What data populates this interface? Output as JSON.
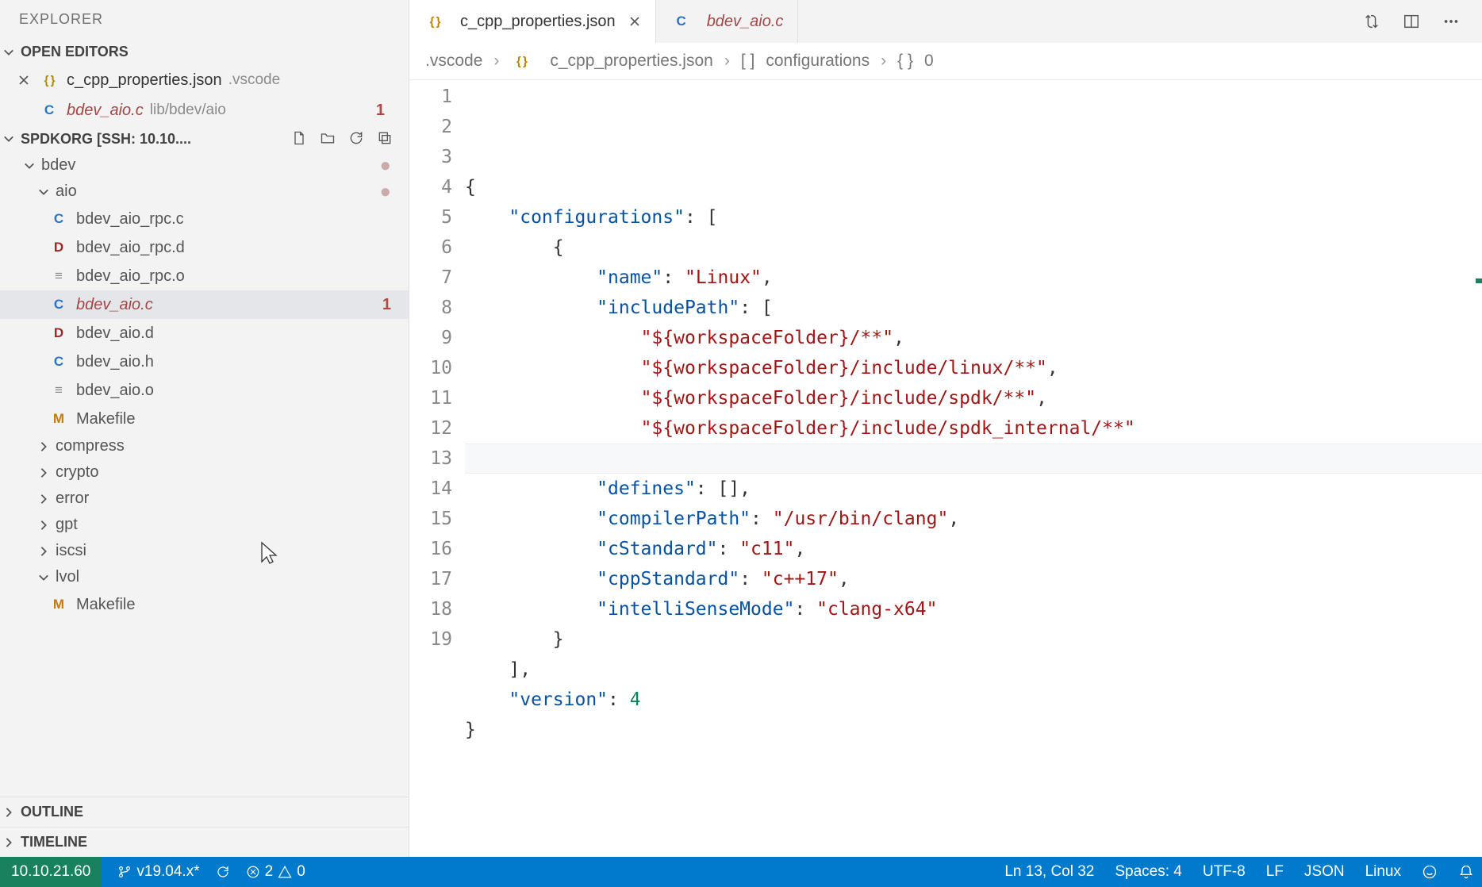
{
  "explorer_title": "EXPLORER",
  "open_editors_label": "OPEN EDITORS",
  "open_editors": [
    {
      "name": "c_cpp_properties.json",
      "path": ".vscode",
      "icon": "json",
      "modified": false,
      "badge": ""
    },
    {
      "name": "bdev_aio.c",
      "path": "lib/bdev/aio",
      "icon": "c",
      "modified": true,
      "badge": "1"
    }
  ],
  "workspace_label": "SPDKORG [SSH: 10.10....",
  "tree": {
    "bdev": {
      "label": "bdev",
      "dot": true
    },
    "aio": {
      "label": "aio",
      "dot": true
    },
    "files_aio": [
      {
        "name": "bdev_aio_rpc.c",
        "icon": "c"
      },
      {
        "name": "bdev_aio_rpc.d",
        "icon": "d"
      },
      {
        "name": "bdev_aio_rpc.o",
        "icon": "o"
      },
      {
        "name": "bdev_aio.c",
        "icon": "c",
        "modified": true,
        "badge": "1",
        "selected": true
      },
      {
        "name": "bdev_aio.d",
        "icon": "d"
      },
      {
        "name": "bdev_aio.h",
        "icon": "c"
      },
      {
        "name": "bdev_aio.o",
        "icon": "o"
      },
      {
        "name": "Makefile",
        "icon": "m"
      }
    ],
    "folders_after": [
      {
        "name": "compress"
      },
      {
        "name": "crypto"
      },
      {
        "name": "error"
      },
      {
        "name": "gpt"
      },
      {
        "name": "iscsi"
      }
    ],
    "lvol": {
      "label": "lvol"
    },
    "lvol_files": [
      {
        "name": "Makefile",
        "icon": "m"
      }
    ]
  },
  "outline_label": "OUTLINE",
  "timeline_label": "TIMELINE",
  "tabs": [
    {
      "name": "c_cpp_properties.json",
      "icon": "json",
      "active": true,
      "close": true
    },
    {
      "name": "bdev_aio.c",
      "icon": "c",
      "active": false,
      "modified": true
    }
  ],
  "breadcrumb": {
    "b0": ".vscode",
    "b1": "c_cpp_properties.json",
    "b2": "configurations",
    "b3": "0"
  },
  "code": {
    "line_count": 19,
    "current_line": 13,
    "json": {
      "configurations": [
        {
          "name": "Linux",
          "includePath": [
            "${workspaceFolder}/**",
            "${workspaceFolder}/include/linux/**",
            "${workspaceFolder}/include/spdk/**",
            "${workspaceFolder}/include/spdk_internal/**"
          ],
          "defines": [],
          "compilerPath": "/usr/bin/clang",
          "cStandard": "c11",
          "cppStandard": "c++17",
          "intelliSenseMode": "clang-x64"
        }
      ],
      "version": 4
    }
  },
  "statusbar": {
    "remote_host": "10.10.21.60",
    "branch": "v19.04.x*",
    "errors": "2",
    "warnings": "0",
    "cursor": "Ln 13, Col 32",
    "spaces": "Spaces: 4",
    "encoding": "UTF-8",
    "eol": "LF",
    "lang": "JSON",
    "os": "Linux"
  }
}
